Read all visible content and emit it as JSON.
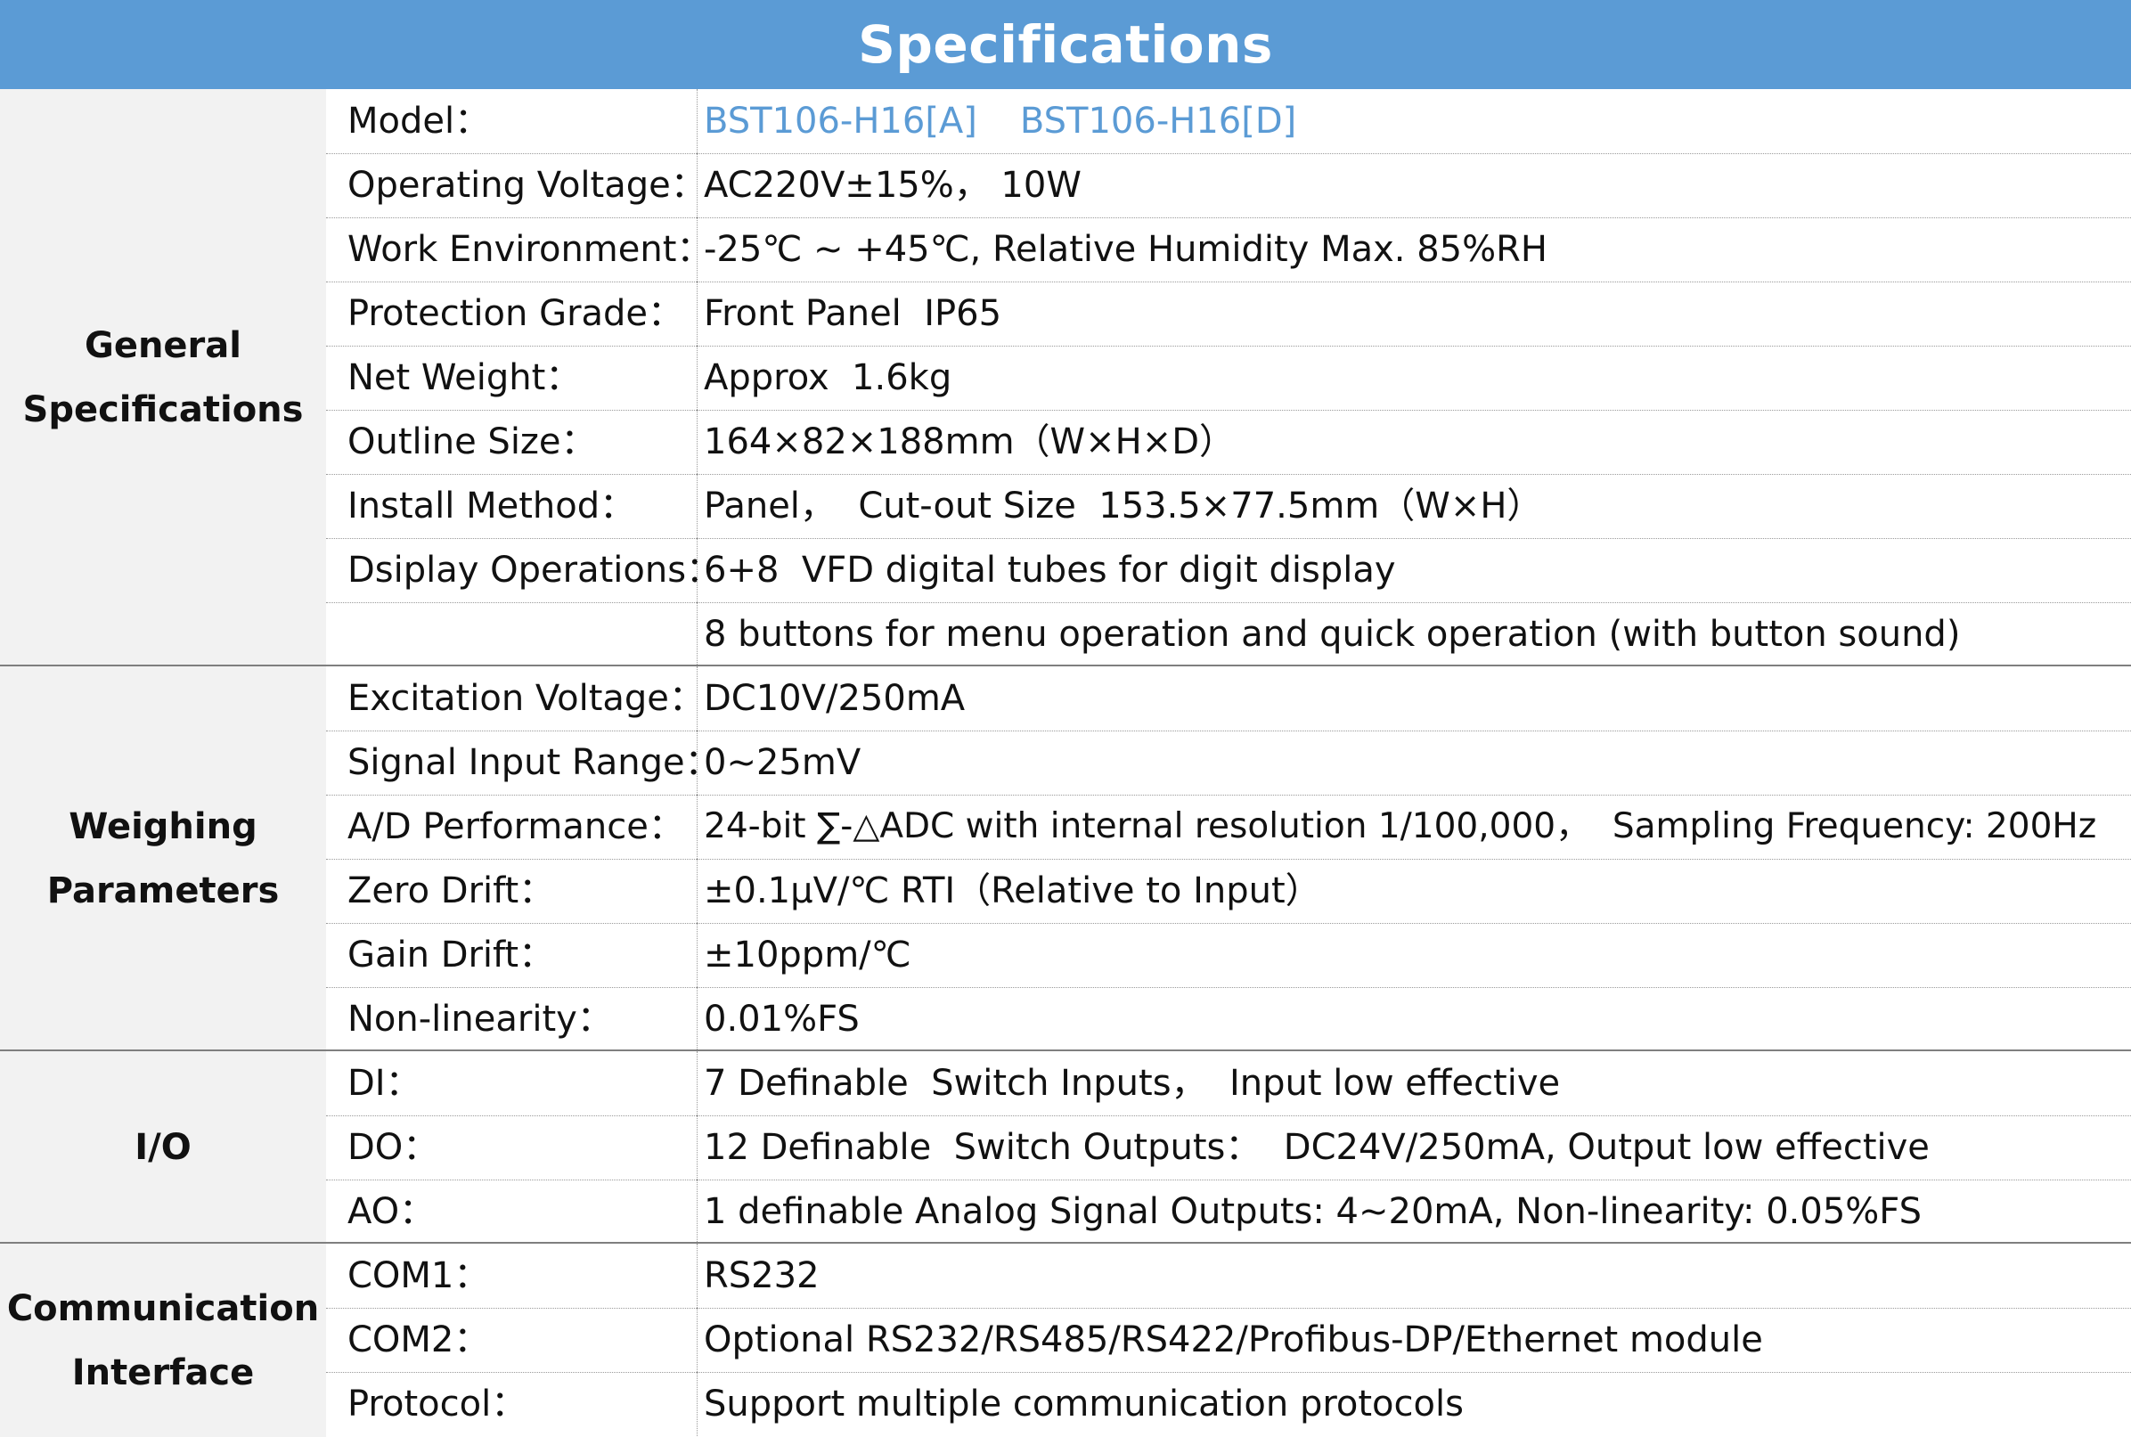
{
  "title": "Specifications",
  "sections": [
    {
      "label_line1": "General",
      "label_line2": "Specifications",
      "rows": [
        {
          "label": "Model：",
          "value": ""
        },
        {
          "label": "Operating Voltage：",
          "value": "AC220V±15%， 10W"
        },
        {
          "label": "Work Environment：",
          "value": "-25℃ ~ +45℃, Relative Humidity Max. 85%RH"
        },
        {
          "label": "Protection Grade：",
          "value": "Front Panel  IP65"
        },
        {
          "label": "Net Weight：",
          "value": "Approx  1.6kg"
        },
        {
          "label": "Outline Size：",
          "value": "164×82×188mm（W×H×D）"
        },
        {
          "label": "Install  Method：",
          "value": "Panel，  Cut-out Size  153.5×77.5mm（W×H）"
        },
        {
          "label": "Dsiplay Operations：",
          "value": "6+8  VFD digital tubes for digit display"
        },
        {
          "label": "",
          "value": "8 buttons for menu operation and quick operation (with button sound)"
        }
      ],
      "model_values": [
        "BST106-H16[A]",
        "BST106-H16[D]"
      ]
    },
    {
      "label_line1": "Weighing",
      "label_line2": "Parameters",
      "rows": [
        {
          "label": "Excitation Voltage：",
          "value": "DC10V/250mA"
        },
        {
          "label": "Signal Input Range：",
          "value": "0~25mV"
        },
        {
          "label": "A/D Performance：",
          "value": "24-bit ∑-△ADC with internal resolution 1/100,000，  Sampling Frequency: 200Hz"
        },
        {
          "label": "Zero Drift：",
          "value": "±0.1μV/℃ RTI（Relative to Input）"
        },
        {
          "label": "Gain Drift：",
          "value": "±10ppm/℃"
        },
        {
          "label": "Non-linearity：",
          "value": "0.01%FS"
        }
      ]
    },
    {
      "label_line1": "I/O",
      "label_line2": "",
      "rows": [
        {
          "label": "DI：",
          "value": "7 Definable  Switch Inputs，  Input low effective"
        },
        {
          "label": "DO：",
          "value": "12 Definable  Switch Outputs：  DC24V/250mA, Output low effective"
        },
        {
          "label": "AO：",
          "value": "1 definable Analog Signal Outputs: 4~20mA, Non-linearity: 0.05%FS"
        }
      ]
    },
    {
      "label_line1": "Communication",
      "label_line2": "Interface",
      "rows": [
        {
          "label": "COM1：",
          "value": "RS232"
        },
        {
          "label": "COM2：",
          "value": "Optional RS232/RS485/RS422/Profibus-DP/Ethernet module"
        },
        {
          "label": "Protocol：",
          "value": "Support multiple communication protocols"
        }
      ]
    }
  ]
}
